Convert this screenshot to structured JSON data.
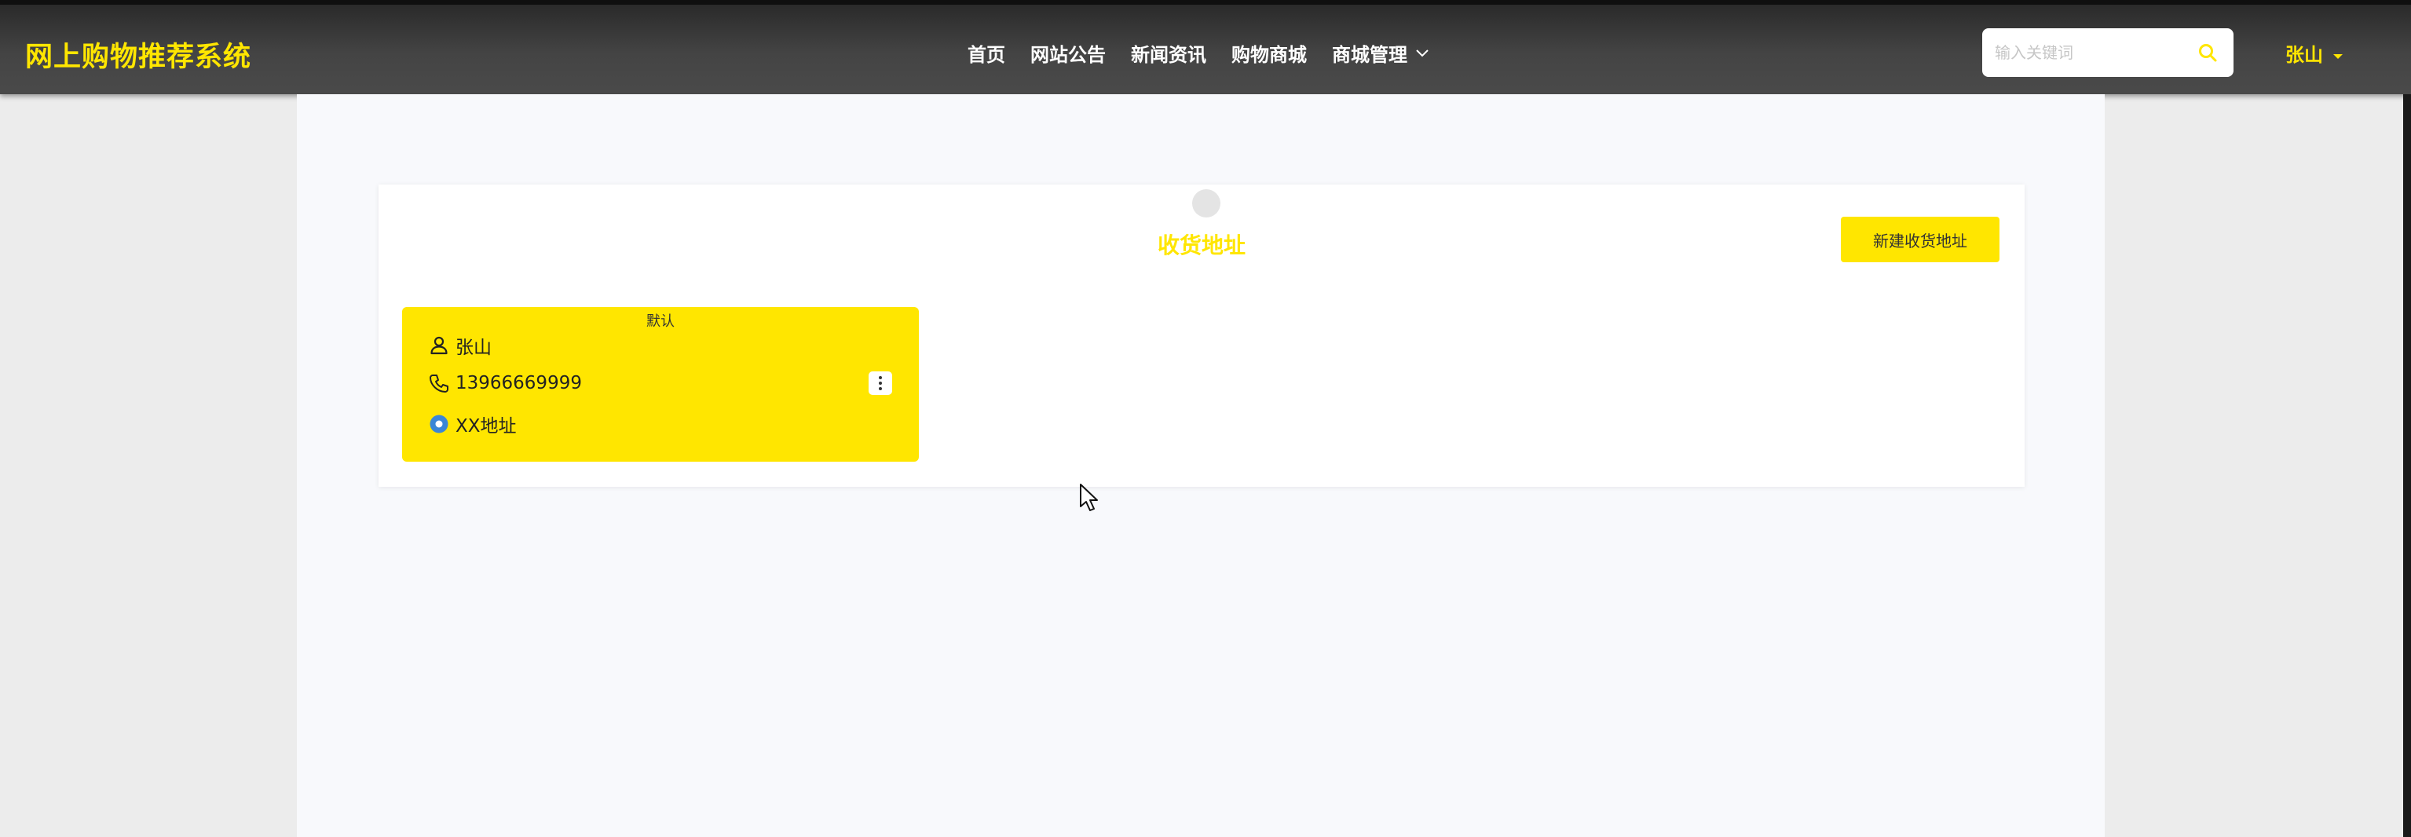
{
  "header": {
    "brand": "网上购物推荐系统",
    "nav": [
      {
        "label": "首页"
      },
      {
        "label": "网站公告"
      },
      {
        "label": "新闻资讯"
      },
      {
        "label": "购物商城"
      },
      {
        "label": "商城管理",
        "has_dropdown": true
      }
    ],
    "search": {
      "placeholder": "输入关键词",
      "value": ""
    },
    "user": {
      "name": "张山"
    }
  },
  "page": {
    "title": "收货地址",
    "new_button": "新建收货地址"
  },
  "addresses": [
    {
      "default_tag": "默认",
      "name": "张山",
      "phone": "13966669999",
      "address": "XX地址",
      "is_default": true
    }
  ],
  "colors": {
    "accent": "#ffe600",
    "header_bg": "#444444",
    "page_bg": "#f8f9fc",
    "location_icon": "#3a86d6"
  },
  "icons": {
    "search": "search-icon",
    "user_caret": "caret-down-icon",
    "nav_dropdown": "chevron-down-icon",
    "person": "person-icon",
    "phone": "phone-icon",
    "location": "location-icon",
    "more": "more-vertical-icon"
  }
}
